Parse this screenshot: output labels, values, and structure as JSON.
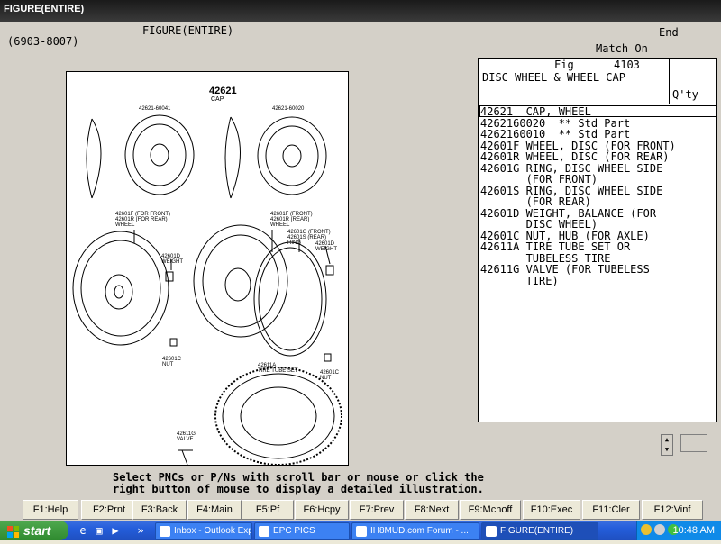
{
  "window": {
    "title": "FIGURE(ENTIRE)"
  },
  "header": {
    "range": "(6903-8007)",
    "figure_label": "FIGURE(ENTIRE)",
    "end_label": "End",
    "match_label": "Match On"
  },
  "figure": {
    "fig_label": "Fig",
    "fig_number": "4103",
    "title": "DISC WHEEL & WHEEL CAP",
    "qty_label": "Q'ty"
  },
  "illustration": {
    "cap_code": "42621",
    "cap_name": "CAP",
    "labels": {
      "cap_left": "42621-60041",
      "cap_right": "42621-60020",
      "wheel_left": "42601F (FOR FRONT)\n42601R (FOR REAR)\nWHEEL",
      "weight_left": "42601D\nWEIGHT",
      "wheel_right": "42601F (FRONT)\n42601R (REAR)\nWHEEL",
      "ring_right": "42601G (FRONT)\n42601S (REAR)\nRING",
      "weight_right": "42601D\nWEIGHT",
      "nut_left": "42601C\nNUT",
      "tire": "42611A\nTIRE TUBE SET",
      "nut_right": "42601C\nNUT",
      "valve": "42611G\nVALVE"
    }
  },
  "parts": [
    "42621  CAP, WHEEL",
    "4262160020  ** Std Part",
    "4262160010  ** Std Part",
    "42601F WHEEL, DISC (FOR FRONT)",
    "42601R WHEEL, DISC (FOR REAR)",
    "42601G RING, DISC WHEEL SIDE",
    "       (FOR FRONT)",
    "42601S RING, DISC WHEEL SIDE",
    "       (FOR REAR)",
    "42601D WEIGHT, BALANCE (FOR",
    "       DISC WHEEL)",
    "42601C NUT, HUB (FOR AXLE)",
    "42611A TIRE TUBE SET OR",
    "       TUBELESS TIRE",
    "42611G VALVE (FOR TUBELESS",
    "       TIRE)"
  ],
  "message": "Select PNCs or P/Ns with scroll bar or mouse or click the\nright button of mouse to display a detailed illustration.",
  "fkeys": [
    "F1:Help",
    "F2:Prnt",
    "F3:Back",
    "F4:Main",
    "F5:Pf",
    "F6:Hcpy",
    "F7:Prev",
    "F8:Next",
    "F9:Mchoff",
    "F10:Exec",
    "F11:Cler",
    "F12:Vinf"
  ],
  "taskbar": {
    "start_label": "start",
    "tasks": [
      "Inbox - Outlook Expr...",
      "EPC PICS",
      "IH8MUD.com Forum - ...",
      "FIGURE(ENTIRE)"
    ],
    "clock": "10:48 AM"
  }
}
